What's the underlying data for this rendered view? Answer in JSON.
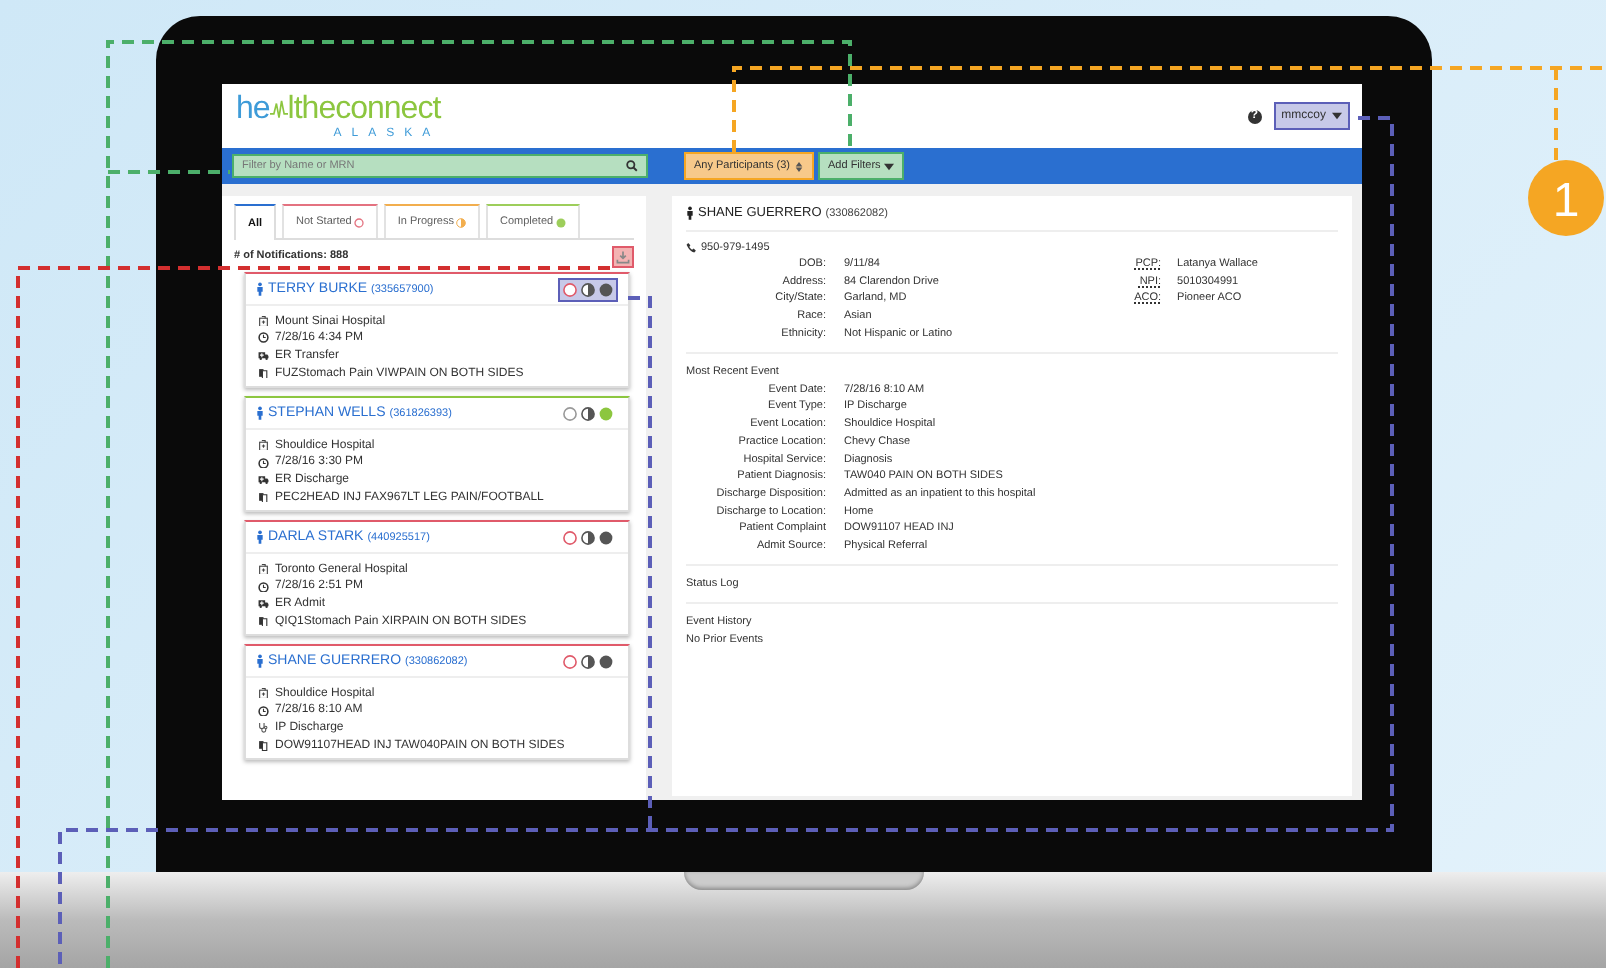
{
  "logo": {
    "word_start": "he",
    "word_end": "ltheconnect",
    "subtitle": "ALASKA"
  },
  "help": {
    "label": "?"
  },
  "user_menu": {
    "label": "mmccoy"
  },
  "search": {
    "placeholder": "Filter by Name or MRN"
  },
  "filters": [
    {
      "label": "Any Participants (3)",
      "kind": "select"
    },
    {
      "label": "Add Filters",
      "kind": "dropdown"
    }
  ],
  "tabs": [
    {
      "label": "All",
      "selected": true,
      "kind": "all"
    },
    {
      "label": "Not Started",
      "selected": false,
      "kind": "new"
    },
    {
      "label": "In Progress",
      "selected": false,
      "kind": "progress"
    },
    {
      "label": "Completed",
      "selected": false,
      "kind": "done"
    }
  ],
  "notification_count": "# of Notifications: 888",
  "patients": [
    {
      "name": "TERRY BURKE",
      "mrn": "(335657900)",
      "completed": false,
      "hospital": "Mount Sinai Hospital",
      "time": "7/28/16 4:34 PM",
      "event": "ER Transfer",
      "kind": "ambulance",
      "complaint": "FUZStomach Pain VIWPAIN ON BOTH SIDES"
    },
    {
      "name": "STEPHAN WELLS",
      "mrn": "(361826393)",
      "completed": true,
      "hospital": "Shouldice Hospital",
      "time": "7/28/16 3:30 PM",
      "event": "ER Discharge",
      "kind": "ambulance",
      "complaint": "PEC2HEAD INJ FAX967LT LEG PAIN/FOOTBALL"
    },
    {
      "name": "DARLA STARK",
      "mrn": "(440925517)",
      "completed": false,
      "hospital": "Toronto General Hospital",
      "time": "7/28/16 2:51 PM",
      "event": "ER Admit",
      "kind": "ambulance",
      "complaint": "QIQ1Stomach Pain XIRPAIN ON BOTH SIDES"
    },
    {
      "name": "SHANE GUERRERO",
      "mrn": "(330862082)",
      "completed": false,
      "hospital": "Shouldice Hospital",
      "time": "7/28/16 8:10 AM",
      "event": "IP Discharge",
      "kind": "stethoscope",
      "complaint": "DOW91107HEAD INJ TAW040PAIN ON BOTH SIDES"
    }
  ],
  "detail": {
    "name": "SHANE GUERRERO",
    "mrn": "(330862082)",
    "phone": "950-979-1495",
    "demographics": [
      {
        "label": "DOB:",
        "value": "9/11/84"
      },
      {
        "label": "Address:",
        "value": "84 Clarendon Drive"
      },
      {
        "label": "City/State:",
        "value": "Garland, MD"
      },
      {
        "label": "Race:",
        "value": "Asian"
      },
      {
        "label": "Ethnicity:",
        "value": "Not Hispanic or Latino"
      }
    ],
    "providers": [
      {
        "label": "PCP:",
        "value": "Latanya Wallace"
      },
      {
        "label": "NPI:",
        "value": "5010304991"
      },
      {
        "label": "ACO:",
        "value": "Pioneer ACO"
      }
    ],
    "recent_event": {
      "title": "Most Recent Event",
      "fields": [
        {
          "label": "Event Date:",
          "value": "7/28/16 8:10 AM"
        },
        {
          "label": "Event Type:",
          "value": "IP Discharge"
        },
        {
          "label": "Event Location:",
          "value": "Shouldice Hospital"
        },
        {
          "label": "Practice Location:",
          "value": "Chevy Chase"
        },
        {
          "label": "Hospital Service:",
          "value": "Diagnosis"
        },
        {
          "label": "Patient Diagnosis:",
          "value": "TAW040 PAIN ON BOTH SIDES"
        },
        {
          "label": "Discharge Disposition:",
          "value": "Admitted as an inpatient to this hospital"
        },
        {
          "label": "Discharge to Location:",
          "value": "Home"
        },
        {
          "label": "Patient Complaint",
          "value": "DOW91107 HEAD INJ"
        },
        {
          "label": "Admit Source:",
          "value": "Physical Referral"
        }
      ]
    },
    "sections": [
      {
        "title": "Status Log"
      },
      {
        "title": "Event History",
        "note": "No Prior Events"
      }
    ]
  },
  "callout": {
    "number": "1"
  }
}
